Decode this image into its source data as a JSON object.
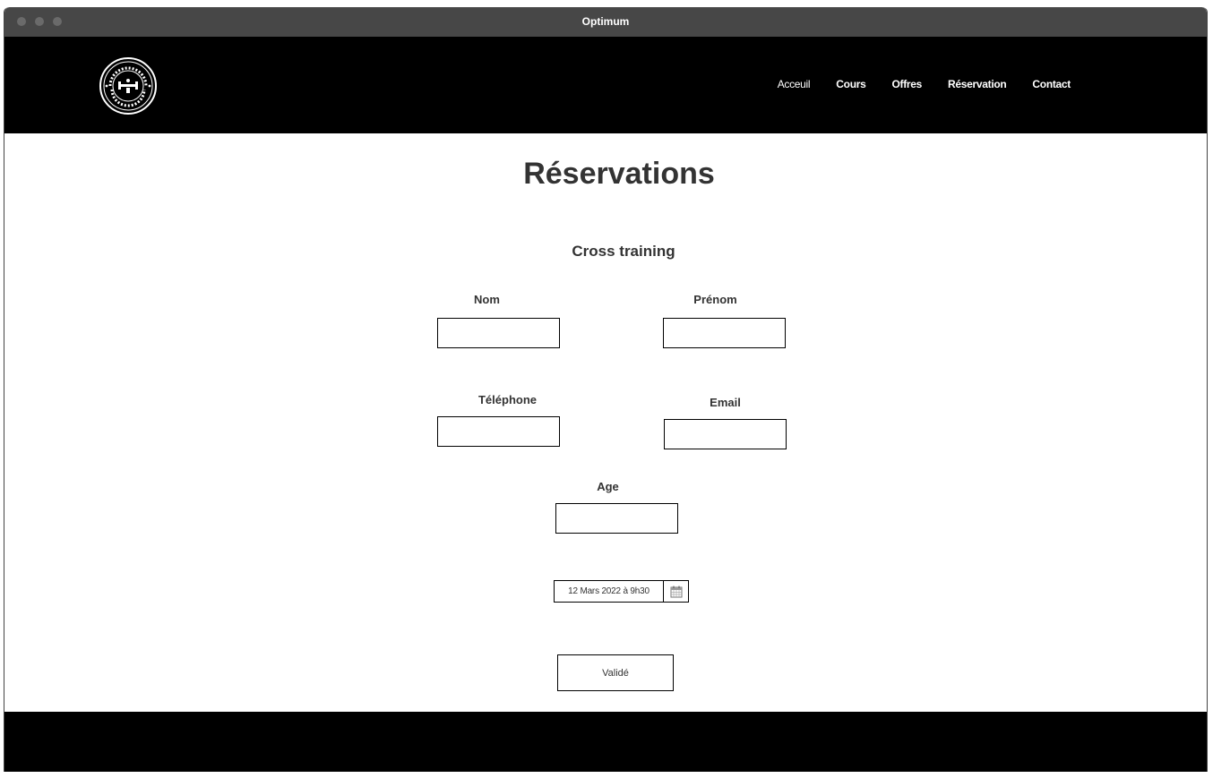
{
  "window": {
    "title": "Optimum"
  },
  "nav": {
    "links": [
      {
        "label": "Acceuil"
      },
      {
        "label": "Cours"
      },
      {
        "label": "Offres"
      },
      {
        "label": "Réservation"
      },
      {
        "label": "Contact"
      }
    ]
  },
  "main": {
    "title": "Réservations",
    "course": "Cross training",
    "form": {
      "nom_label": "Nom",
      "prenom_label": "Prénom",
      "telephone_label": "Téléphone",
      "email_label": "Email",
      "age_label": "Age",
      "date_value": "12 Mars 2022 à 9h30",
      "submit_label": "Validé"
    }
  },
  "icons": {
    "date_picker": "calendar-icon",
    "logo": "optimum-fitness-logo"
  },
  "colors": {
    "nav_bg": "#000000",
    "footer_bg": "#000000",
    "text": "#333333",
    "titlebar": "#474747"
  }
}
